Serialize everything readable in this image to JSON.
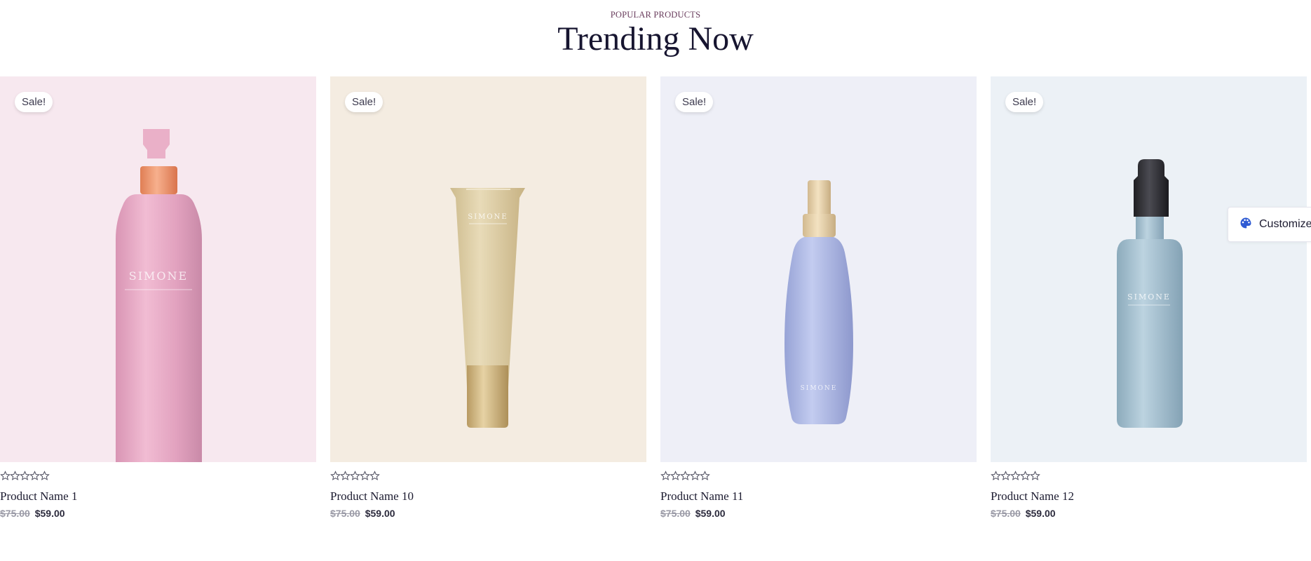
{
  "header": {
    "eyebrow": "POPULAR PRODUCTS",
    "title": "Trending Now"
  },
  "products": [
    {
      "badge": "Sale!",
      "name": "Product Name 1",
      "old_price": "$75.00",
      "price": "$59.00",
      "rating": 0,
      "bg": "#f7e8ef",
      "bottle": "pink-pump-bottle",
      "brand": "SIMONE"
    },
    {
      "badge": "Sale!",
      "name": "Product Name 10",
      "old_price": "$75.00",
      "price": "$59.00",
      "rating": 0,
      "bg": "#f4ece1",
      "bottle": "gold-tube",
      "brand": "SIMONE"
    },
    {
      "badge": "Sale!",
      "name": "Product Name 11",
      "old_price": "$75.00",
      "price": "$59.00",
      "rating": 0,
      "bg": "#eeeff7",
      "bottle": "lavender-spray-bottle",
      "brand": "SIMONE"
    },
    {
      "badge": "Sale!",
      "name": "Product Name 12",
      "old_price": "$75.00",
      "price": "$59.00",
      "rating": 0,
      "bg": "#ecf1f6",
      "bottle": "blue-dropper-bottle",
      "brand": "SIMONE"
    }
  ],
  "customize": {
    "label": "Customize",
    "icon": "palette-icon",
    "icon_color": "#2f5bd3"
  }
}
